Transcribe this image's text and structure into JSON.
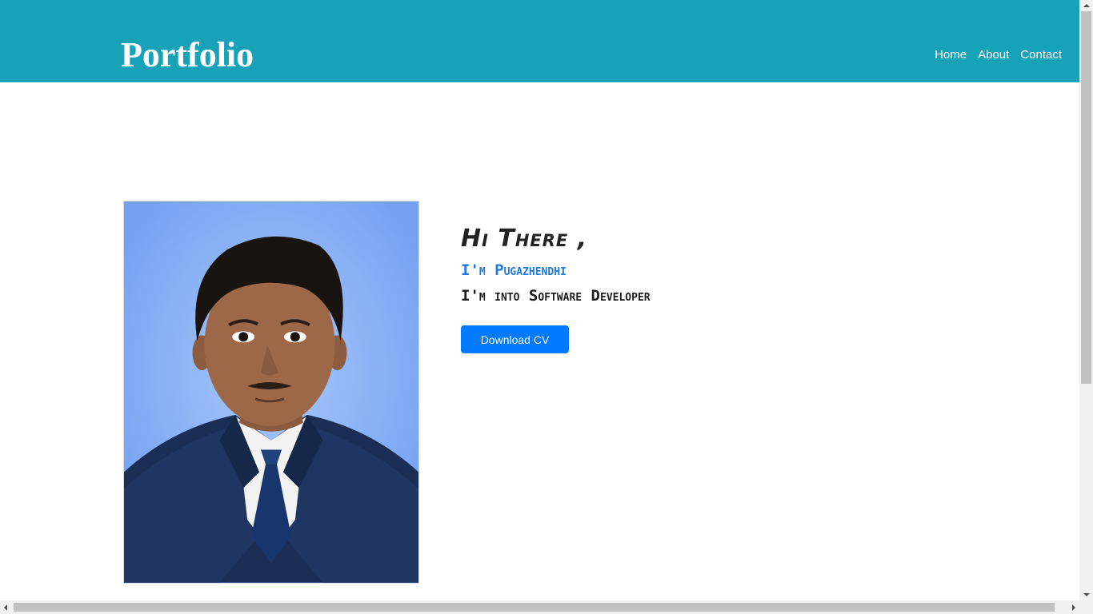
{
  "navbar": {
    "brand": "Portfolio",
    "links": [
      "Home",
      "About",
      "Contact"
    ],
    "color": "#17a2b8"
  },
  "profile": {
    "photo_icon": "person-portrait",
    "photo_background": "#7aa5f2"
  },
  "hero": {
    "greeting": "Hi There ,",
    "name_line": "I'm Pugazhendhi",
    "role_line": "I'm into Software Developer",
    "name_color": "#1f7be0"
  },
  "actions": {
    "download_label": "Download CV",
    "button_color": "#007bff"
  }
}
